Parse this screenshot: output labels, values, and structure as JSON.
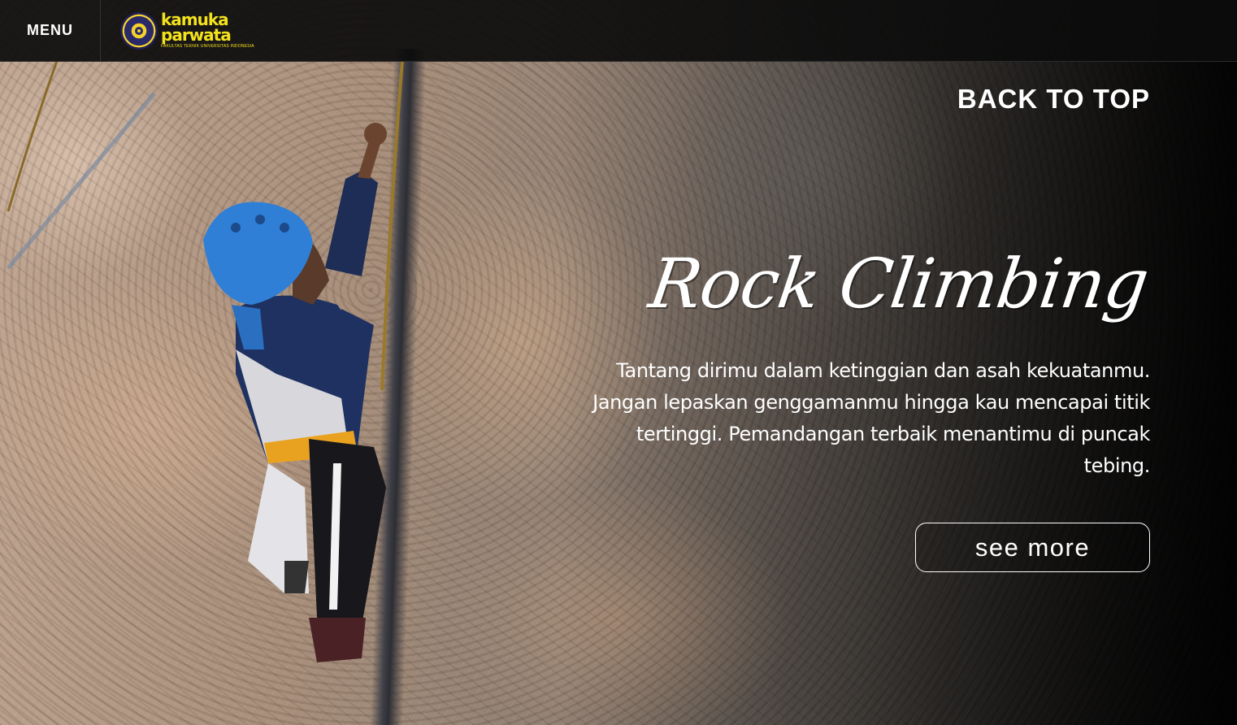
{
  "header": {
    "menu_label": "MENU",
    "logo": {
      "word_line1": "kamuka",
      "word_line2": "parwata",
      "subtitle": "FAKULTAS TEKNIK UNIVERSITAS INDONESIA",
      "color": "#f4e21d"
    }
  },
  "hero": {
    "back_to_top_label": "BACK TO TOP",
    "title": "Rock Climbing",
    "description": "Tantang dirimu dalam ketinggian dan asah kekuatanmu. Jangan lepaskan genggamanmu hingga kau mencapai titik tertinggi. Pemandangan terbaik menantimu di puncak tebing.",
    "see_more_label": "see more",
    "background_image": "rock-climber-photo"
  },
  "colors": {
    "text": "#ffffff",
    "topbar_bg": "#0c0c0c",
    "accent_yellow": "#f4e21d",
    "helmet_blue": "#2f7fd6"
  }
}
